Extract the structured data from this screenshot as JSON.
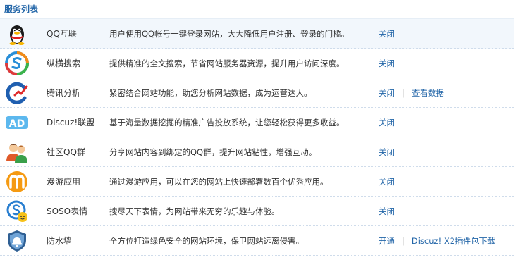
{
  "header": {
    "title": "服务列表"
  },
  "services": [
    {
      "icon": "qq-penguin-icon",
      "name": "QQ互联",
      "desc": "用户使用QQ帐号一键登录网站，大大降低用户注册、登录的门槛。",
      "actions": [
        "关闭"
      ]
    },
    {
      "icon": "search-engine-icon",
      "name": "纵横搜索",
      "desc": "提供精准的全文搜索，节省网站服务器资源，提升用户访问深度。",
      "actions": [
        "关闭"
      ]
    },
    {
      "icon": "analytics-icon",
      "name": "腾讯分析",
      "desc": "紧密结合网站功能，助您分析网站数据，成为运营达人。",
      "actions": [
        "关闭",
        "查看数据"
      ]
    },
    {
      "icon": "ad-icon",
      "name": "Discuz!联盟",
      "desc": "基于海量数据挖掘的精准广告投放系统，让您轻松获得更多收益。",
      "actions": [
        "关闭"
      ]
    },
    {
      "icon": "qq-group-icon",
      "name": "社区QQ群",
      "desc": "分享网站内容到绑定的QQ群，提升网站粘性，增强互动。",
      "actions": [
        "关闭"
      ]
    },
    {
      "icon": "manyou-app-icon",
      "name": "漫游应用",
      "desc": "通过漫游应用，可以在您的网站上快速部署数百个优秀应用。",
      "actions": [
        "关闭"
      ]
    },
    {
      "icon": "soso-emoticon-icon",
      "name": "SOSO表情",
      "desc": "搜尽天下表情，为网站带来无穷的乐趣与体验。",
      "actions": [
        "关闭"
      ]
    },
    {
      "icon": "firewall-shield-icon",
      "name": "防水墙",
      "desc": "全方位打造绿色安全的网站环境，保卫网站远离侵害。",
      "actions": [
        "开通",
        "Discuz! X2插件包下载"
      ]
    }
  ]
}
